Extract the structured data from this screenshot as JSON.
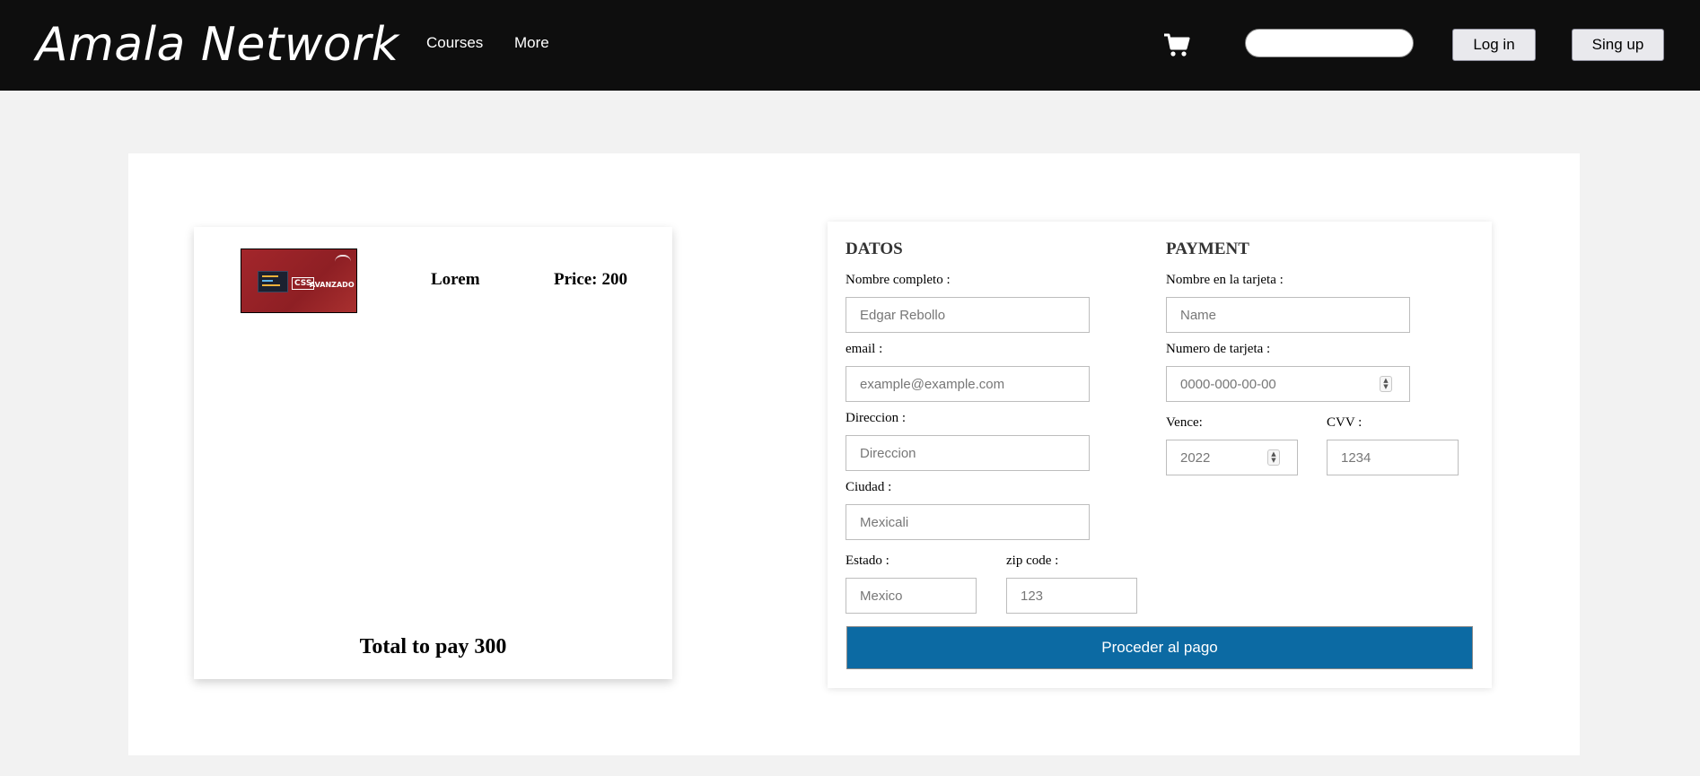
{
  "header": {
    "brand": "Amala Network",
    "nav": [
      {
        "label": "Courses"
      },
      {
        "label": "More"
      }
    ],
    "cart_icon": "shopping-cart-icon",
    "search": {
      "value": "",
      "placeholder": ""
    },
    "login_label": "Log in",
    "signup_label": "Sing up"
  },
  "cart": {
    "items": [
      {
        "thumbnail": {
          "badge": "CSS",
          "caption": "AVANZADO"
        },
        "name": "Lorem",
        "price_label": "Price:",
        "price": "200"
      }
    ],
    "total_label": "Total to pay",
    "total": "300"
  },
  "form": {
    "datos": {
      "title": "DATOS",
      "full_name": {
        "label": "Nombre completo :",
        "placeholder": "Edgar Rebollo",
        "value": ""
      },
      "email": {
        "label": "email :",
        "placeholder": "example@example.com",
        "value": ""
      },
      "address": {
        "label": "Direccion :",
        "placeholder": "Direccion",
        "value": ""
      },
      "city": {
        "label": "Ciudad :",
        "placeholder": "Mexicali",
        "value": ""
      },
      "state": {
        "label": "Estado :",
        "placeholder": "Mexico",
        "value": ""
      },
      "zip": {
        "label": "zip code :",
        "placeholder": "123",
        "value": ""
      }
    },
    "payment": {
      "title": "PAYMENT",
      "card_name": {
        "label": "Nombre en la tarjeta :",
        "placeholder": "Name",
        "value": ""
      },
      "card_number": {
        "label": "Numero de tarjeta :",
        "placeholder": "0000-000-00-00",
        "value": ""
      },
      "expires": {
        "label": "Vence:",
        "placeholder": "2022",
        "value": ""
      },
      "cvv": {
        "label": "CVV :",
        "placeholder": "1234",
        "value": ""
      }
    },
    "submit_label": "Proceder al pago"
  },
  "colors": {
    "header_bg": "#0e0e0e",
    "page_bg": "#f2f2f2",
    "submit_bg": "#0c6aa3",
    "thumbnail_bg": "#a3262b"
  }
}
